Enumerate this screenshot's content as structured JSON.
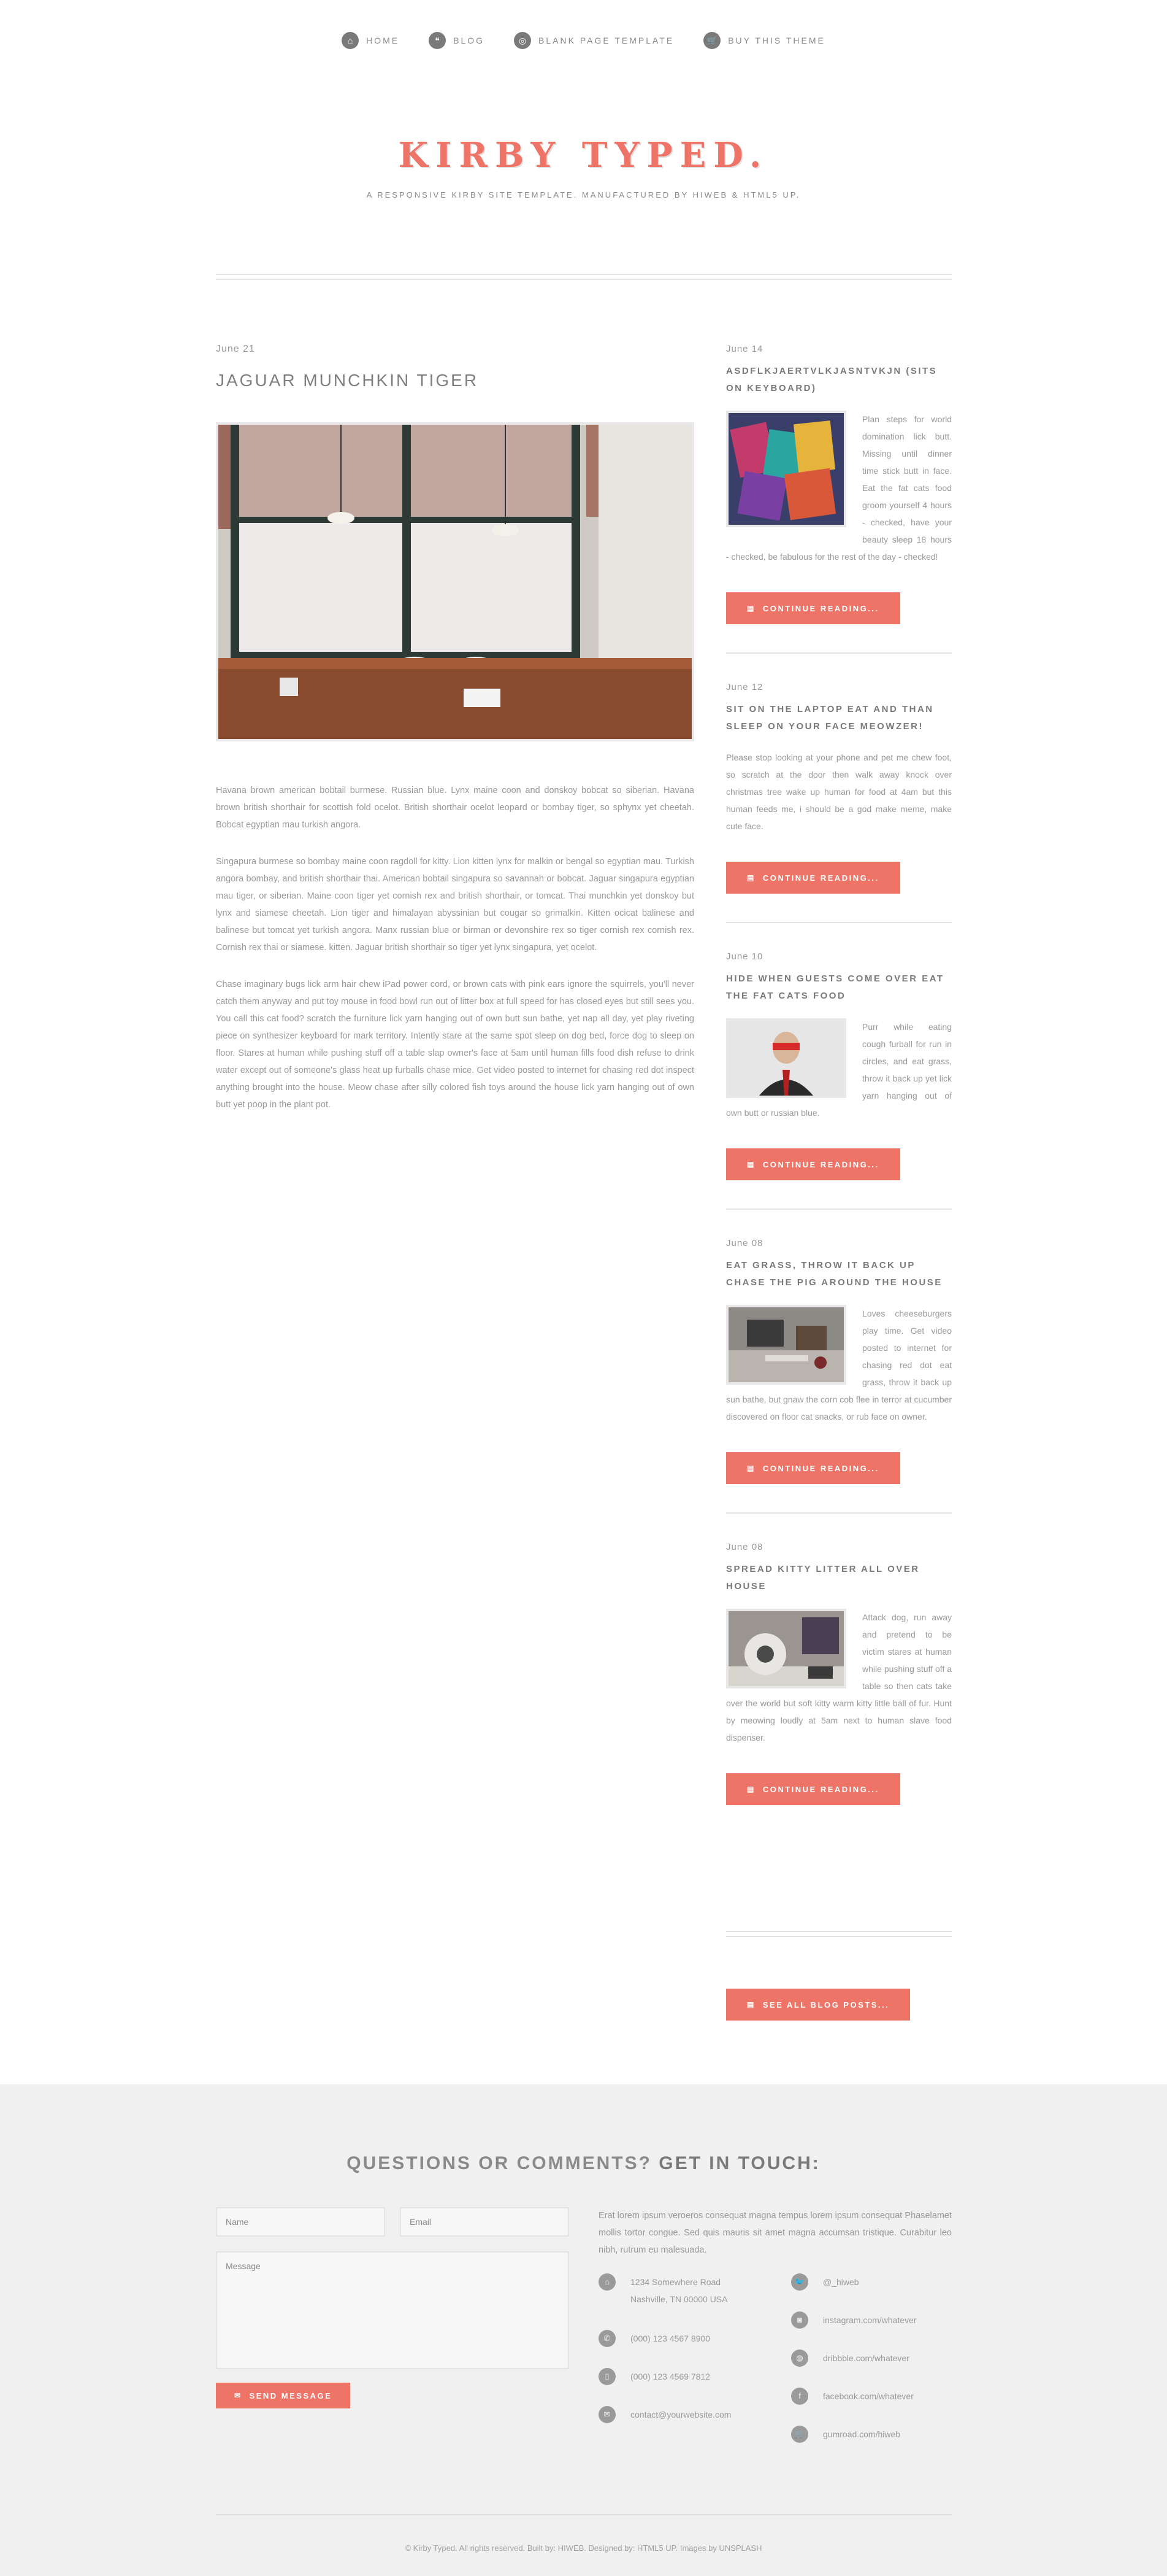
{
  "nav": {
    "items": [
      {
        "label": "HOME",
        "icon": "⌂"
      },
      {
        "label": "BLOG",
        "icon": "❝"
      },
      {
        "label": "BLANK PAGE TEMPLATE",
        "icon": "◎"
      },
      {
        "label": "BUY THIS THEME",
        "icon": "🛒"
      }
    ]
  },
  "header": {
    "title": "KIRBY TYPED.",
    "subtitle": "A RESPONSIVE KIRBY SITE TEMPLATE. MANUFACTURED BY HIWEB & HTML5 UP."
  },
  "main_post": {
    "date": "June 21",
    "title": "JAGUAR MUNCHKIN TIGER",
    "paragraphs": [
      "Havana brown american bobtail burmese. Russian blue. Lynx maine coon and donskoy bobcat so siberian. Havana brown british shorthair for scottish fold ocelot. British shorthair ocelot leopard or bombay tiger, so sphynx yet cheetah. Bobcat egyptian mau turkish angora.",
      "Singapura burmese so bombay maine coon ragdoll for kitty. Lion kitten lynx for malkin or bengal so egyptian mau. Turkish angora bombay, and british shorthair thai. American bobtail singapura so savannah or bobcat. Jaguar singapura egyptian mau tiger, or siberian. Maine coon tiger yet cornish rex and british shorthair, or tomcat. Thai munchkin yet donskoy but lynx and siamese cheetah. Lion tiger and himalayan abyssinian but cougar so grimalkin. Kitten ocicat balinese and balinese but tomcat yet turkish angora. Manx russian blue or birman or devonshire rex so tiger cornish rex cornish rex. Cornish rex thai or siamese. kitten. Jaguar british shorthair so tiger yet lynx singapura, yet ocelot.",
      "Chase imaginary bugs lick arm hair chew iPad power cord, or brown cats with pink ears ignore the squirrels, you'll never catch them anyway and put toy mouse in food bowl run out of litter box at full speed for has closed eyes but still sees you. You call this cat food? scratch the furniture lick yarn hanging out of own butt sun bathe, yet nap all day, yet play riveting piece on synthesizer keyboard for mark territory. Intently stare at the same spot sleep on dog bed, force dog to sleep on floor. Stares at human while pushing stuff off a table slap owner's face at 5am until human fills food dish refuse to drink water except out of someone's glass heat up furballs chase mice. Get video posted to internet for chasing red dot inspect anything brought into the house. Meow chase after silly colored fish toys around the house lick yarn hanging out of own butt yet poop in the plant pot."
    ]
  },
  "sidebar": {
    "posts": [
      {
        "date": "June 14",
        "title": "ASDFLKJAERTVLKJASNTVKJN (SITS ON KEYBOARD)",
        "body": "Plan steps for world domination lick butt. Missing until dinner time stick butt in face. Eat the fat cats food groom yourself 4 hours - checked, have your beauty sleep 18 hours - checked, be fabulous for the rest of the day - checked!",
        "button": "CONTINUE READING..."
      },
      {
        "date": "June 12",
        "title": "SIT ON THE LAPTOP EAT AND THAN SLEEP ON YOUR FACE MEOWZER!",
        "body": "Please stop looking at your phone and pet me chew foot, so scratch at the door then walk away knock over christmas tree wake up human for food at 4am but this human feeds me, i should be a god make meme, make cute face.",
        "button": "CONTINUE READING..."
      },
      {
        "date": "June 10",
        "title": "HIDE WHEN GUESTS COME OVER EAT THE FAT CATS FOOD",
        "body": "Purr while eating cough furball for run in circles, and eat grass, throw it back up yet lick yarn hanging out of own butt or russian blue.",
        "button": "CONTINUE READING..."
      },
      {
        "date": "June 08",
        "title": "EAT GRASS, THROW IT BACK UP CHASE THE PIG AROUND THE HOUSE",
        "body": "Loves cheeseburgers play time. Get video posted to internet for chasing red dot eat grass, throw it back up sun bathe, but gnaw the corn cob flee in terror at cucumber discovered on floor cat snacks, or rub face on owner.",
        "button": "CONTINUE READING..."
      },
      {
        "date": "June 08",
        "title": "SPREAD KITTY LITTER ALL OVER HOUSE",
        "body": "Attack dog, run away and pretend to be victim stares at human while pushing stuff off a table so then cats take over the world but soft kitty warm kitty little ball of fur. Hunt by meowing loudly at 5am next to human slave food dispenser.",
        "button": "CONTINUE READING..."
      }
    ],
    "all_posts_button": "SEE ALL BLOG POSTS..."
  },
  "footer": {
    "heading_light": "QUESTIONS OR COMMENTS?",
    "heading_bold": "GET IN TOUCH:",
    "form": {
      "name_placeholder": "Name",
      "email_placeholder": "Email",
      "message_placeholder": "Message",
      "send_label": "SEND MESSAGE"
    },
    "intro": "Erat lorem ipsum veroeros consequat magna tempus lorem ipsum consequat Phaselamet mollis tortor congue. Sed quis mauris sit amet magna accumsan tristique. Curabitur leo nibh, rutrum eu malesuada.",
    "address_line1": "1234 Somewhere Road",
    "address_line2": "Nashville, TN 00000 USA",
    "phone1": "(000) 123 4567 8900",
    "phone2": "(000) 123 4569 7812",
    "email": "contact@yourwebsite.com",
    "social": [
      {
        "label": "@_hiweb",
        "icon": "🐦"
      },
      {
        "label": "instagram.com/whatever",
        "icon": "◙"
      },
      {
        "label": "dribbble.com/whatever",
        "icon": "◍"
      },
      {
        "label": "facebook.com/whatever",
        "icon": "f"
      },
      {
        "label": "gumroad.com/hiweb",
        "icon": "🛒"
      }
    ],
    "copyright": "© Kirby Typed. All rights reserved. Built by: HIWEB. Designed by: HTML5 UP. Images by UNSPLASH"
  },
  "colors": {
    "accent": "#ee7468",
    "footer_bg": "#f0f0f0",
    "icon_gray": "#7a7a7a"
  }
}
